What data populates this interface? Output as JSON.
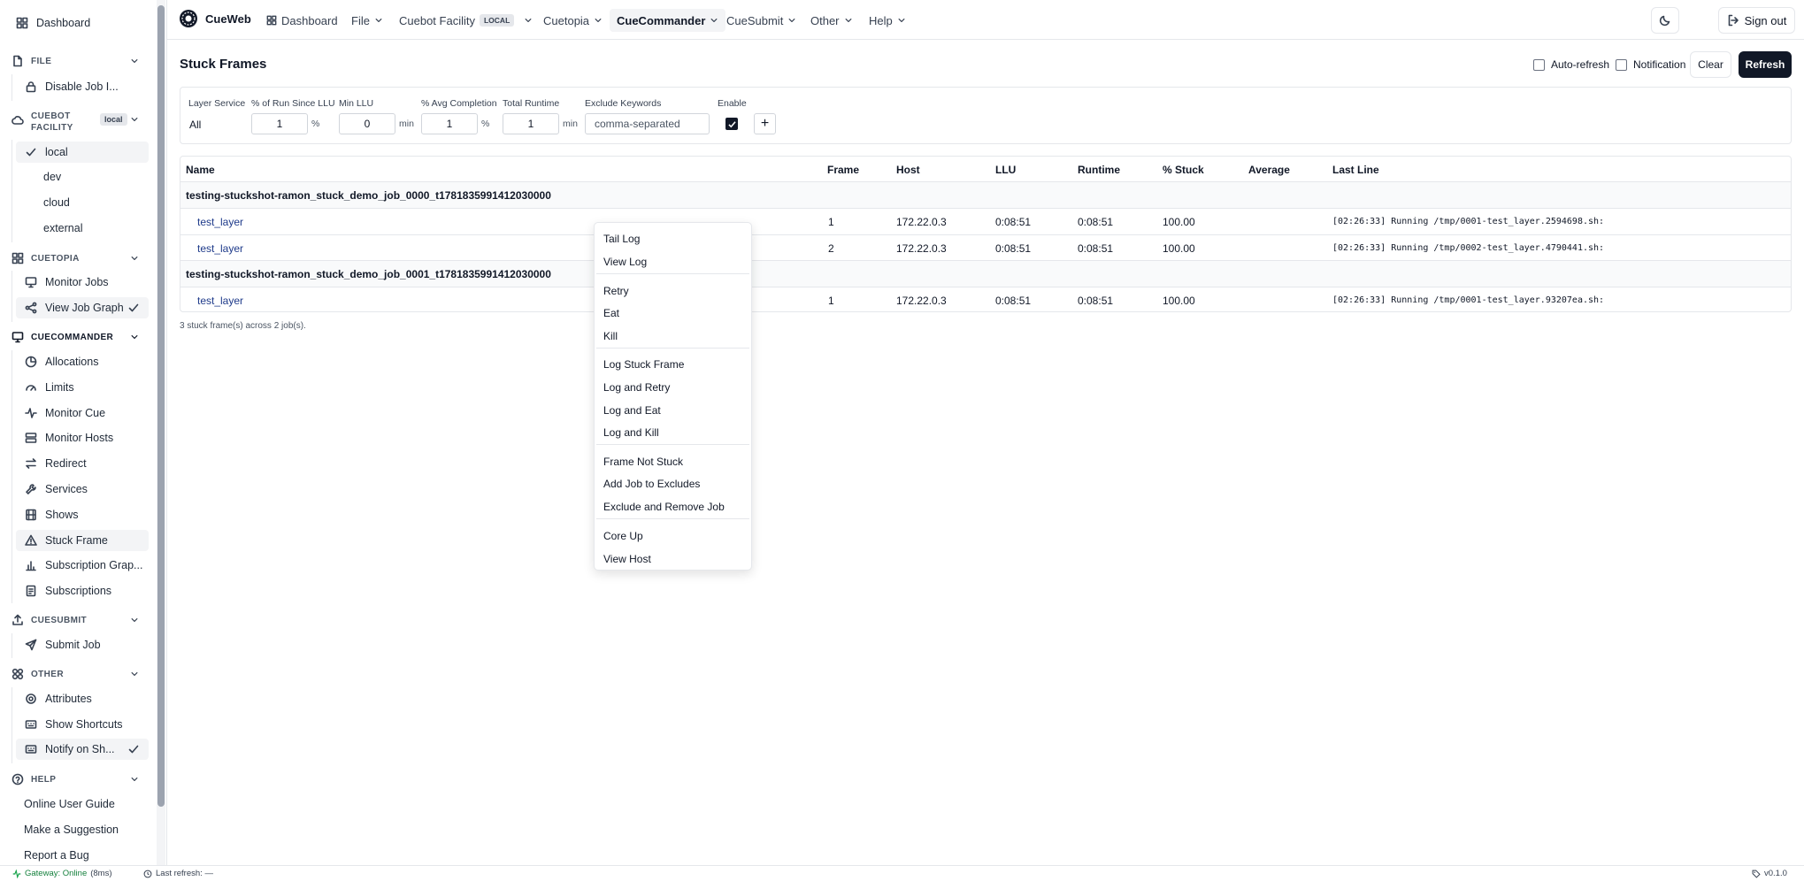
{
  "sidebar": {
    "dashboard": "Dashboard",
    "sections": {
      "file": "FILE",
      "facility_a": "CUEBOT",
      "facility_b": "FACILITY",
      "facility_badge": "local",
      "cuetopia": "CUETOPIA",
      "cuecommander": "CUECOMMANDER",
      "cuesubmit": "CUESUBMIT",
      "other": "OTHER",
      "help": "HELP"
    },
    "file_items": [
      "Disable Job I..."
    ],
    "facility_items": [
      "local",
      "dev",
      "cloud",
      "external"
    ],
    "cuetopia_items": [
      "Monitor Jobs",
      "View Job Graph"
    ],
    "cuecommander_items": [
      "Allocations",
      "Limits",
      "Monitor Cue",
      "Monitor Hosts",
      "Redirect",
      "Services",
      "Shows",
      "Stuck Frame",
      "Subscription Grap...",
      "Subscriptions"
    ],
    "cuesubmit_items": [
      "Submit Job"
    ],
    "other_items": [
      "Attributes",
      "Show Shortcuts",
      "Notify on Sh..."
    ],
    "help_items": [
      "Online User Guide",
      "Make a Suggestion",
      "Report a Bug"
    ]
  },
  "topbar": {
    "brand": "CueWeb",
    "nav": {
      "dashboard": "Dashboard",
      "file": "File",
      "facility": "Cuebot Facility",
      "facility_badge": "LOCAL",
      "cuetopia": "Cuetopia",
      "cuecommander": "CueCommander",
      "cuesubmit": "CueSubmit",
      "other": "Other",
      "help": "Help"
    },
    "sign_out": "Sign out"
  },
  "page": {
    "title": "Stuck Frames",
    "auto_refresh": "Auto-refresh",
    "notification": "Notification",
    "clear": "Clear",
    "refresh": "Refresh"
  },
  "filters": {
    "labels": {
      "layer_service": "Layer Service",
      "run_since_llu": "% of Run Since LLU",
      "min_llu": "Min LLU",
      "avg_completion": "% Avg Completion",
      "total_runtime": "Total Runtime",
      "exclude_keywords": "Exclude Keywords",
      "enable": "Enable"
    },
    "values": {
      "layer_service": "All",
      "run_since_llu": "1",
      "min_llu": "0",
      "avg_completion": "1",
      "total_runtime": "1"
    },
    "units": {
      "pct1": "%",
      "min1": "min",
      "pct2": "%",
      "min2": "min"
    },
    "exclude_placeholder": "comma-separated",
    "add": "+"
  },
  "table": {
    "headers": [
      "Name",
      "Frame",
      "Host",
      "LLU",
      "Runtime",
      "% Stuck",
      "Average",
      "Last Line"
    ],
    "groups": [
      {
        "job": "testing-stuckshot-ramon_stuck_demo_job_0000_t1781835991412030000",
        "rows": [
          {
            "name": "test_layer",
            "frame": "1",
            "host": "172.22.0.3",
            "llu": "0:08:51",
            "runtime": "0:08:51",
            "stuck": "100.00",
            "average": "",
            "last_line": "[02:26:33] Running /tmp/0001-test_layer.2594698.sh:"
          },
          {
            "name": "test_layer",
            "frame": "2",
            "host": "172.22.0.3",
            "llu": "0:08:51",
            "runtime": "0:08:51",
            "stuck": "100.00",
            "average": "",
            "last_line": "[02:26:33] Running /tmp/0002-test_layer.4790441.sh:"
          }
        ]
      },
      {
        "job": "testing-stuckshot-ramon_stuck_demo_job_0001_t1781835991412030000",
        "rows": [
          {
            "name": "test_layer",
            "frame": "1",
            "host": "172.22.0.3",
            "llu": "0:08:51",
            "runtime": "0:08:51",
            "stuck": "100.00",
            "average": "",
            "last_line": "[02:26:33] Running /tmp/0001-test_layer.93207ea.sh:"
          }
        ]
      }
    ],
    "summary": "3 stuck frame(s) across 2 job(s)."
  },
  "context_menu": {
    "items": [
      "Tail Log",
      "View Log",
      "Retry",
      "Eat",
      "Kill",
      "Log Stuck Frame",
      "Log and Retry",
      "Log and Eat",
      "Log and Kill",
      "Frame Not Stuck",
      "Add Job to Excludes",
      "Exclude and Remove Job",
      "Core Up",
      "View Host"
    ]
  },
  "status": {
    "gateway": "Gateway: Online",
    "latency": "(8ms)",
    "last_refresh": "Last refresh: —",
    "version": "v0.1.0"
  },
  "colors": {
    "accent_dark": "#111827",
    "online": "#16a34a",
    "active_bg": "#f3f4f6"
  }
}
